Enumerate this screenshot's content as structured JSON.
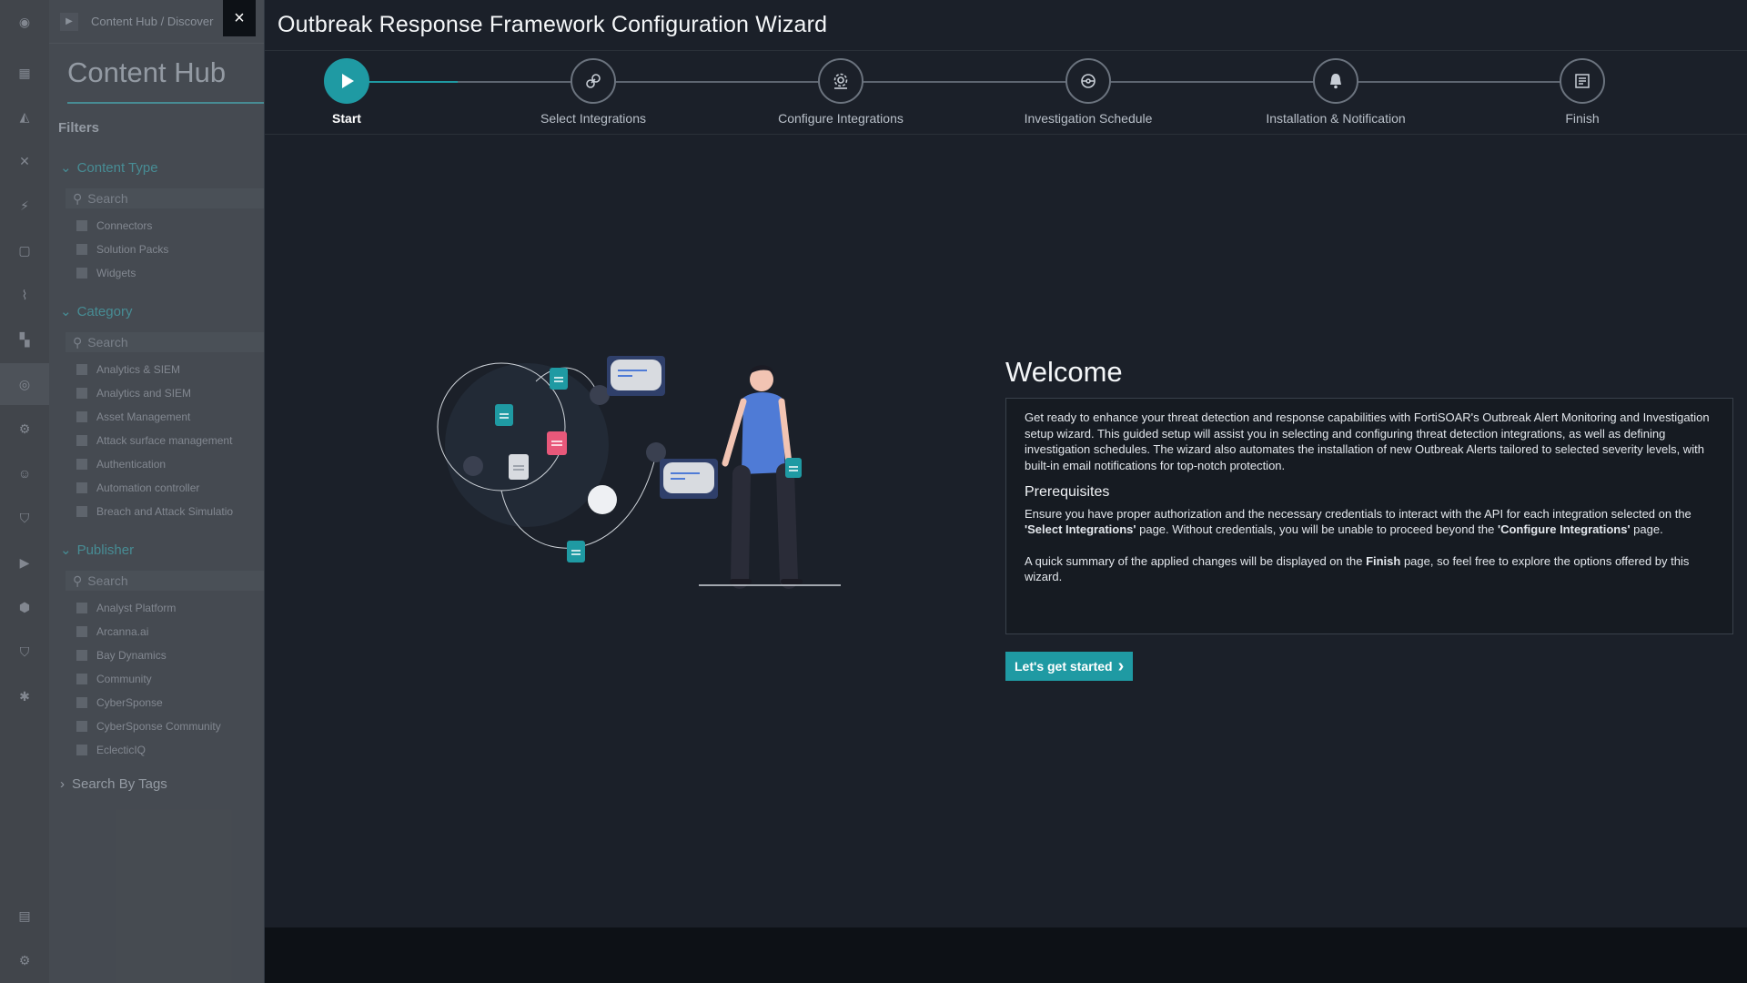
{
  "background_app": {
    "breadcrumb": [
      "Content Hub",
      "/",
      "Discover"
    ],
    "hub_title": "Content Hub",
    "filters_heading": "Filters",
    "groups": [
      {
        "title": "Content Type",
        "search_placeholder": "Search",
        "items": [
          "Connectors",
          "Solution Packs",
          "Widgets"
        ]
      },
      {
        "title": "Category",
        "search_placeholder": "Search",
        "items": [
          "Analytics & SIEM",
          "Analytics and SIEM",
          "Asset Management",
          "Attack surface management",
          "Authentication",
          "Automation controller",
          "Breach and Attack Simulatio"
        ]
      },
      {
        "title": "Publisher",
        "search_placeholder": "Search",
        "items": [
          "Analyst Platform",
          "Arcanna.ai",
          "Bay Dynamics",
          "Community",
          "CyberSponse",
          "CyberSponse Community",
          "EclecticIQ"
        ]
      }
    ],
    "search_by_tags": "Search By Tags",
    "rail_icons": [
      "logo-icon",
      "dashboard-icon",
      "alerts-icon",
      "workflow-icon",
      "automation-icon",
      "briefcase-icon",
      "reports-icon",
      "apps-icon",
      "content-hub-icon",
      "settings-icon",
      "users-icon",
      "shield-icon",
      "playbook-icon",
      "threat-icon",
      "security-icon",
      "bug-icon",
      "clipboard-icon",
      "help-icon"
    ]
  },
  "close_label": "×",
  "modal": {
    "title": "Outbreak Response Framework Configuration Wizard",
    "steps": [
      {
        "label": "Start",
        "icon": "play-icon",
        "active": true
      },
      {
        "label": "Select Integrations",
        "icon": "link-icon",
        "active": false
      },
      {
        "label": "Configure Integrations",
        "icon": "gear-icon",
        "active": false
      },
      {
        "label": "Investigation Schedule",
        "icon": "schedule-icon",
        "active": false
      },
      {
        "label": "Installation & Notification",
        "icon": "bell-icon",
        "active": false
      },
      {
        "label": "Finish",
        "icon": "summary-icon",
        "active": false
      }
    ],
    "welcome_title": "Welcome",
    "intro": "Get ready to enhance your threat detection and response capabilities with FortiSOAR's Outbreak Alert Monitoring and Investigation setup wizard. This guided setup will assist you in selecting and configuring threat detection integrations, as well as defining investigation schedules. The wizard also automates the installation of new Outbreak Alerts tailored to selected severity levels, with built-in email notifications for top-notch protection.",
    "prereq_title": "Prerequisites",
    "prereq": {
      "t1": "Ensure you have proper authorization and the necessary credentials to interact with the API for each integration selected on the ",
      "b1": "'Select Integrations'",
      "t2": " page. Without credentials, you will be unable to proceed beyond the ",
      "b2": "'Configure Integrations'",
      "t3": " page."
    },
    "summary": {
      "t1": "A quick summary of the applied changes will be displayed on the ",
      "b1": "Finish",
      "t2": " page, so feel free to explore the options offered by this wizard."
    },
    "start_button": "Let's get started",
    "start_arrow": "›"
  },
  "colors": {
    "accent": "#1f9aa3",
    "pink": "#e8587a",
    "figure_blue": "#4f7bd6"
  }
}
